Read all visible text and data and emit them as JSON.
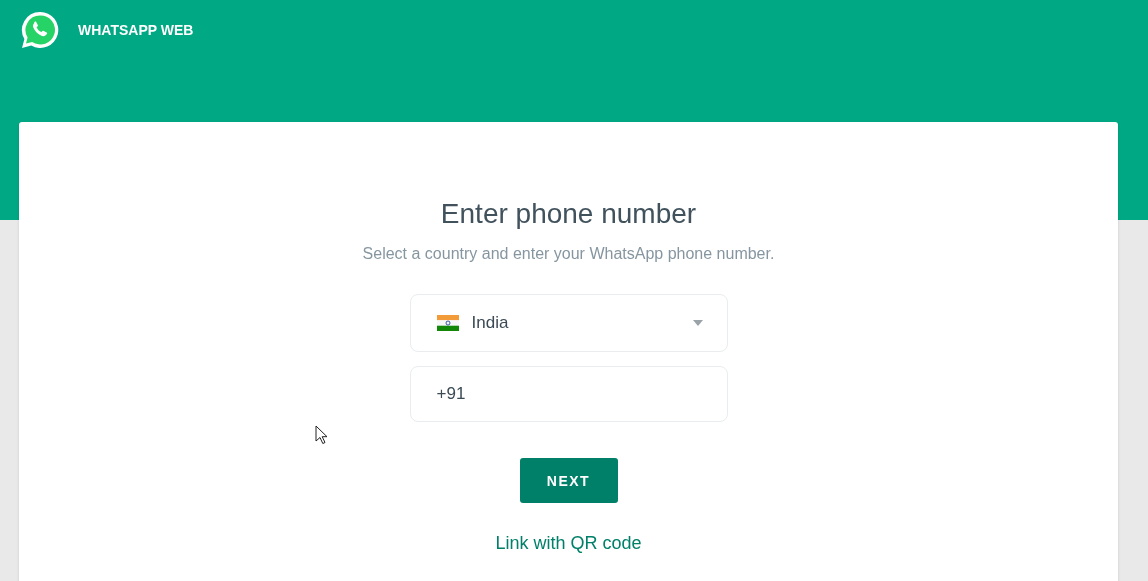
{
  "header": {
    "title": "WHATSAPP WEB"
  },
  "card": {
    "title": "Enter phone number",
    "subtitle": "Select a country and enter your WhatsApp phone number.",
    "country": {
      "name": "India"
    },
    "phone": {
      "value": "+91"
    },
    "next_button": "NEXT",
    "link": "Link with QR code"
  }
}
